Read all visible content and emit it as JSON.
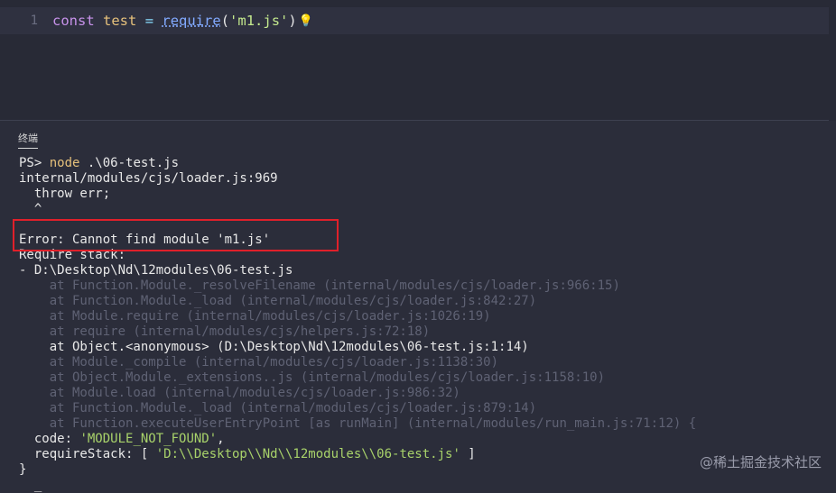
{
  "editor": {
    "line_number": "1",
    "code": {
      "keyword": "const",
      "variable": "test",
      "operator": "=",
      "function": "require",
      "open_paren": "(",
      "string": "'m1.js'",
      "close_paren": ")"
    }
  },
  "panel": {
    "tab_label": "终端"
  },
  "terminal": {
    "prompt": "PS> ",
    "command": "node",
    "command_args": " .\\06-test.js",
    "line_internal": "internal/modules/cjs/loader.js:969",
    "line_throw": "  throw err;",
    "line_caret": "  ^",
    "line_blank": "",
    "line_error": "Error: Cannot find module 'm1.js'",
    "line_require_stack": "Require stack:",
    "line_stack_path": "- D:\\Desktop\\Nd\\12modules\\06-test.js",
    "stack": [
      {
        "text": "    at Function.Module._resolveFilename (internal/modules/cjs/loader.js:966:15)",
        "dim": true
      },
      {
        "text": "    at Function.Module._load (internal/modules/cjs/loader.js:842:27)",
        "dim": true
      },
      {
        "text": "    at Module.require (internal/modules/cjs/loader.js:1026:19)",
        "dim": true
      },
      {
        "text": "    at require (internal/modules/cjs/helpers.js:72:18)",
        "dim": true
      },
      {
        "text": "    at Object.<anonymous> (D:\\Desktop\\Nd\\12modules\\06-test.js:1:14)",
        "dim": false
      },
      {
        "text": "    at Module._compile (internal/modules/cjs/loader.js:1138:30)",
        "dim": true
      },
      {
        "text": "    at Object.Module._extensions..js (internal/modules/cjs/loader.js:1158:10)",
        "dim": true
      },
      {
        "text": "    at Module.load (internal/modules/cjs/loader.js:986:32)",
        "dim": true
      },
      {
        "text": "    at Function.Module._load (internal/modules/cjs/loader.js:879:14)",
        "dim": true
      },
      {
        "text": "    at Function.executeUserEntryPoint [as runMain] (internal/modules/run_main.js:71:12) {",
        "dim": true
      }
    ],
    "code_key": "  code: ",
    "code_value": "'MODULE_NOT_FOUND'",
    "code_tail": ",",
    "requirestack_key": "  requireStack: [ ",
    "requirestack_value": "'D:\\\\Desktop\\\\Nd\\\\12modules\\\\06-test.js'",
    "requirestack_tail": " ]",
    "line_close": "}",
    "cursor": "  _"
  },
  "watermark": "@稀土掘金技术社区",
  "colors": {
    "highlight_box": "#e0202a",
    "keyword": "#c792ea",
    "string": "#c3e88d"
  }
}
